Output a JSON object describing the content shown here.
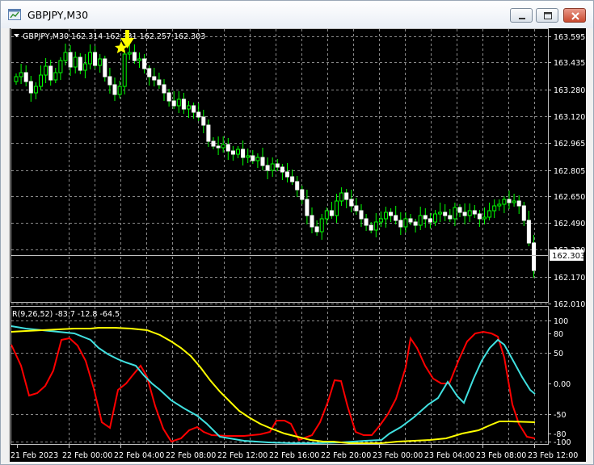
{
  "window": {
    "title": "GBPJPY,M30",
    "icon": "chart-window-icon",
    "controls": [
      "minimize-icon",
      "maximize-icon",
      "close-icon"
    ]
  },
  "main_chart": {
    "header": "GBPJPY,M30  162.314 162.331 162.257 162.303",
    "current_price_label": "162.303",
    "price_ticks": [
      "163.595",
      "163.435",
      "163.280",
      "163.120",
      "162.965",
      "162.805",
      "162.650",
      "162.490",
      "162.330",
      "162.170",
      "162.010"
    ],
    "bull_color": "#00ff00",
    "bear_color": "#ffffff",
    "marker_color": "#ffff00",
    "marker_icons": [
      "star-icon",
      "down-arrow-icon"
    ]
  },
  "indicator": {
    "header": "R(9,26,52) -83.7 -12.8 -64.5",
    "level_ticks": [
      "100",
      "80",
      "50",
      "0.00",
      "-50",
      "-80",
      "-100"
    ],
    "line_colors": [
      "#ff0000",
      "#40e0e0",
      "#ffff00"
    ]
  },
  "time_axis": [
    "21 Feb 2023",
    "22 Feb 00:00",
    "22 Feb 04:00",
    "22 Feb 08:00",
    "22 Feb 12:00",
    "22 Feb 16:00",
    "22 Feb 20:00",
    "23 Feb 00:00",
    "23 Feb 04:00",
    "23 Feb 08:00",
    "23 Feb 12:00"
  ]
}
